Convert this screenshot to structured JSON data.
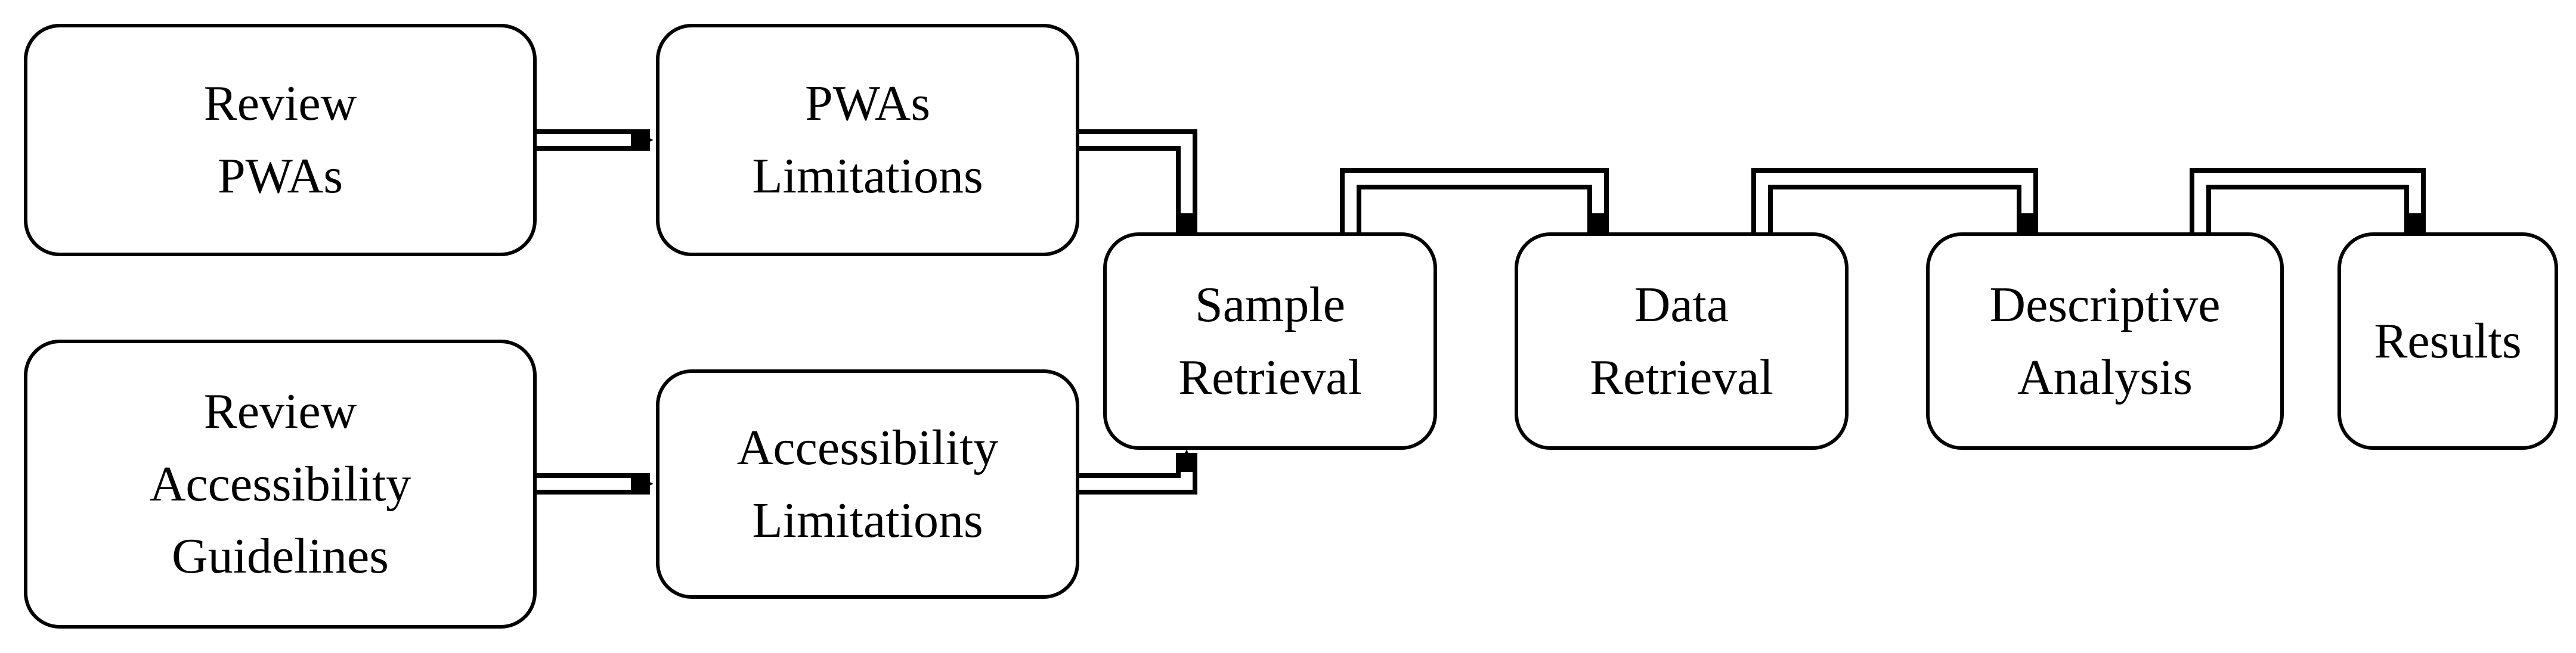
{
  "diagram": {
    "boxes": {
      "review_pwas": "Review\nPWAs",
      "pwas_limitations": "PWAs\nLimitations",
      "review_acc_guidelines": "Review\nAccessibility\nGuidelines",
      "acc_limitations": "Accessibility\nLimitations",
      "sample_retrieval": "Sample\nRetrieval",
      "data_retrieval": "Data\nRetrieval",
      "descriptive_analysis": "Descriptive\nAnalysis",
      "results": "Results"
    }
  }
}
